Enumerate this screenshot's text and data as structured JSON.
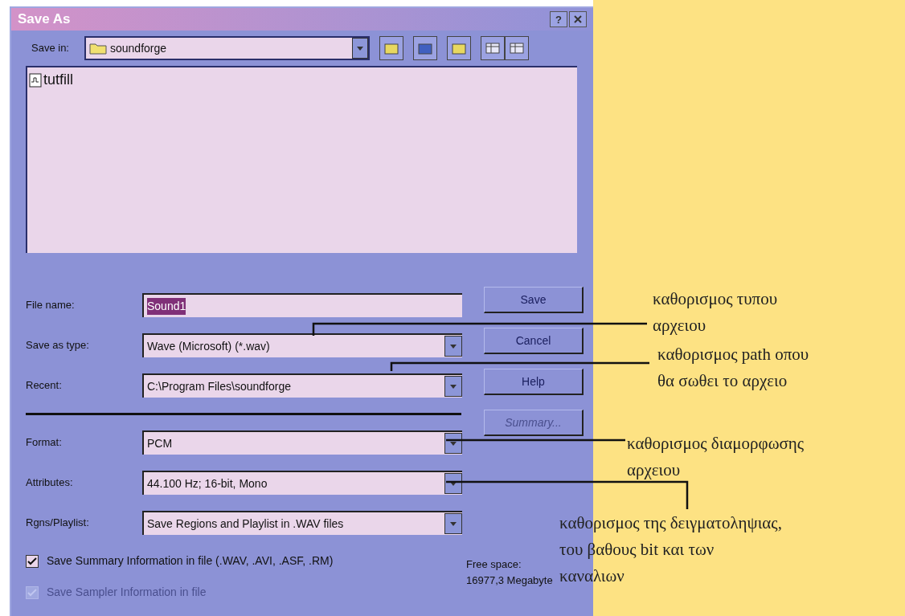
{
  "window": {
    "title": "Save As",
    "help_button": "?"
  },
  "save_in": {
    "label": "Save in:",
    "value": "soundforge"
  },
  "files": [
    {
      "name": "tutfill"
    }
  ],
  "fields": [
    {
      "kind": "text",
      "label": "File name:",
      "value": "Sound1",
      "highlighted": true
    },
    {
      "kind": "combo",
      "label": "Save as type:",
      "value": "Wave (Microsoft) (*.wav)"
    },
    {
      "kind": "combo",
      "label": "Recent:",
      "value": "C:\\Program Files\\soundforge"
    },
    {
      "kind": "divider"
    },
    {
      "kind": "combo",
      "label": "Format:",
      "value": "PCM"
    },
    {
      "kind": "combo",
      "label": "Attributes:",
      "value": "44.100 Hz; 16-bit, Mono"
    },
    {
      "kind": "combo",
      "label": "Rgns/Playlist:",
      "value": "Save Regions and Playlist in .WAV files"
    }
  ],
  "buttons": [
    {
      "label": "Save",
      "disabled": false
    },
    {
      "label": "Cancel",
      "disabled": false
    },
    {
      "label": "Help",
      "disabled": false
    },
    {
      "label": "Summary...",
      "disabled": true
    }
  ],
  "checkboxes": [
    {
      "label": "Save Summary Information in file (.WAV, .AVI, .ASF, .RM)",
      "checked": true,
      "disabled": false
    },
    {
      "label": "Save Sampler Information in file",
      "checked": true,
      "disabled": true
    }
  ],
  "free_space": {
    "label": "Free space:",
    "value": "16977,3 Megabyte"
  },
  "annotations": [
    {
      "text": "καθορισμος τυπου\nαρχειου"
    },
    {
      "text": "καθορισμος path οπου\nθα σωθει το αρχειο"
    },
    {
      "text": "καθορισμος διαμορφωσης\nαρχειου"
    },
    {
      "text": "καθορισμος της δειγματοληψιας,\nτου βαθους bit και των\nκαναλιων"
    }
  ]
}
